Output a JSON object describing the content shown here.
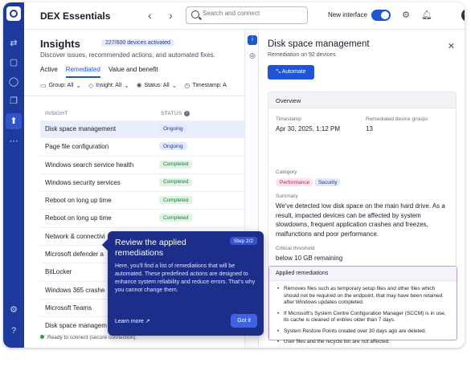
{
  "app": {
    "title": "DEX Essentials"
  },
  "topbar": {
    "search_placeholder": "Search and connect",
    "new_interface_label": "New interface",
    "new_interface_on": true
  },
  "insights": {
    "title": "Insights",
    "devices_badge": "227/600 devices activated",
    "subtitle": "Discover issues, recommended actions, and automated fixes.",
    "tabs": [
      {
        "label": "Active"
      },
      {
        "label": "Remediated",
        "active": true
      },
      {
        "label": "Value and benefit"
      }
    ],
    "filters": [
      {
        "label": "Group: All"
      },
      {
        "label": "Insight: All"
      },
      {
        "label": "Status: All"
      },
      {
        "label": "Timestamp: A"
      }
    ],
    "table": {
      "headers": {
        "insight": "INSIGHT",
        "status": "STATUS"
      },
      "rows": [
        {
          "name": "Disk space management",
          "status": "Ongoing",
          "selected": true
        },
        {
          "name": "Page file configuration",
          "status": "Ongoing"
        },
        {
          "name": "Windows search service health",
          "status": "Completed"
        },
        {
          "name": "Windows security services",
          "status": "Completed"
        },
        {
          "name": "Reboot on long up time",
          "status": "Completed"
        },
        {
          "name": "Reboot on long up time",
          "status": "Completed"
        },
        {
          "name": "Network & connectivi",
          "status": ""
        },
        {
          "name": "Microsoft defender a",
          "status": ""
        },
        {
          "name": "BitLocker",
          "status": ""
        },
        {
          "name": "Windows 365 crashe",
          "status": ""
        },
        {
          "name": "Microsoft Teams",
          "status": ""
        },
        {
          "name": "Disk space managem",
          "status": ""
        }
      ]
    },
    "status_bar": "Ready to connect (secure connection)."
  },
  "tour": {
    "title": "Review the applied remediations",
    "step": "Step 2/2",
    "body": "Here, you'll find a list of remediations that will be automated. These predefined actions are designed to enhance system reliability and reduce errors. That's why you cannot change them.",
    "learn_more": "Learn more",
    "got_it": "Got it"
  },
  "panel": {
    "title": "Disk space management",
    "subtitle": "Remediation on 92 devices",
    "automate_label": "Automate",
    "overview_label": "Overview",
    "timestamp_label": "Timestamp",
    "timestamp_value": "Apr 30, 2025, 1:12 PM",
    "groups_label": "Remediated device groups",
    "groups_value": "13",
    "category_label": "Category",
    "categories": [
      "Performance",
      "Security"
    ],
    "summary_label": "Summary",
    "summary_text": "We've detected low disk space on the main hard drive. As a result, impacted devices can be affected by system slowdowns, frequent application crashes and freezes, malfunctions and poor performance.",
    "threshold_label": "Critical threshold",
    "threshold_value": "below 10 GB remaining",
    "applied_label": "Applied remediations",
    "remediations": [
      "Removes files such as temporary setup files and other files which should not be required on the endpoint, that may have been retained after Windows updates completed.",
      "If Microsoft's System Centre Configuration Manager (SCCM) is in use, its cache is cleaned of entries older than 7 days.",
      "System Restore Points created over 30 days ago are deleted.",
      "User files and the recycle bin are not affected."
    ]
  }
}
